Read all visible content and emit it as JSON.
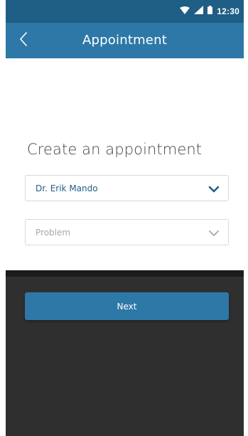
{
  "status_bar": {
    "time": "12:30",
    "icons": [
      "wifi-icon",
      "signal-icon",
      "battery-icon"
    ]
  },
  "app_bar": {
    "title": "Appointment",
    "back_icon": "chevron-left-icon"
  },
  "main": {
    "heading": "Create an appointment",
    "doctor_select": {
      "value": "Dr. Erik Mando",
      "icon": "chevron-down-icon"
    },
    "problem_select": {
      "placeholder": "Problem",
      "icon": "chevron-down-icon"
    }
  },
  "footer": {
    "next_label": "Next"
  },
  "colors": {
    "status_bar": "#1f5e85",
    "app_bar": "#2e78a7",
    "accent": "#1f5e85",
    "dark_panel": "#2f2f2f",
    "button": "#2e78a7"
  }
}
